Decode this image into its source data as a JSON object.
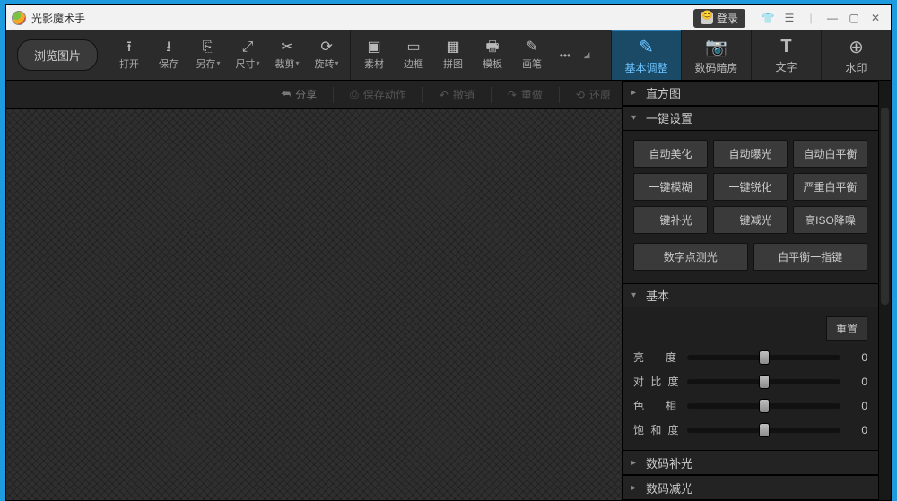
{
  "titlebar": {
    "app_name": "光影魔术手",
    "login_label": "登录"
  },
  "browse_label": "浏览图片",
  "toolbar": [
    {
      "icon": "⭱",
      "label": "打开",
      "dropdown": false
    },
    {
      "icon": "⭳",
      "label": "保存",
      "dropdown": false
    },
    {
      "icon": "⎘",
      "label": "另存",
      "dropdown": true
    },
    {
      "icon": "⤢",
      "label": "尺寸",
      "dropdown": true
    },
    {
      "icon": "✂",
      "label": "裁剪",
      "dropdown": true
    },
    {
      "icon": "⟳",
      "label": "旋转",
      "dropdown": true
    },
    {
      "icon": "▣",
      "label": "素材",
      "dropdown": false
    },
    {
      "icon": "▭",
      "label": "边框",
      "dropdown": false
    },
    {
      "icon": "▦",
      "label": "拼图",
      "dropdown": false
    },
    {
      "icon": "🖶",
      "label": "模板",
      "dropdown": false
    },
    {
      "icon": "✎",
      "label": "画笔",
      "dropdown": false
    }
  ],
  "bigtabs": {
    "basic": {
      "label": "基本调整"
    },
    "darkroom": {
      "label": "数码暗房"
    },
    "text": {
      "label": "文字"
    },
    "watermark": {
      "label": "水印"
    }
  },
  "actionbar": {
    "share": "分享",
    "save_action": "保存动作",
    "undo": "撤销",
    "redo": "重做",
    "revert": "还原"
  },
  "panel": {
    "histogram_title": "直方图",
    "oneclick_title": "一键设置",
    "oneclick_buttons": [
      "自动美化",
      "自动曝光",
      "自动白平衡",
      "一键模糊",
      "一键锐化",
      "严重白平衡",
      "一键补光",
      "一键减光",
      "高ISO降噪"
    ],
    "oneclick_extra": [
      "数字点测光",
      "白平衡一指键"
    ],
    "basic_title": "基本",
    "reset_label": "重置",
    "sliders": {
      "brightness": {
        "label": "亮　度",
        "value": 0
      },
      "contrast": {
        "label": "对 比 度",
        "value": 0
      },
      "hue": {
        "label": "色　相",
        "value": 0
      },
      "saturation": {
        "label": "饱 和 度",
        "value": 0
      }
    },
    "fill_light_title": "数码补光",
    "reduce_light_title": "数码减光"
  }
}
